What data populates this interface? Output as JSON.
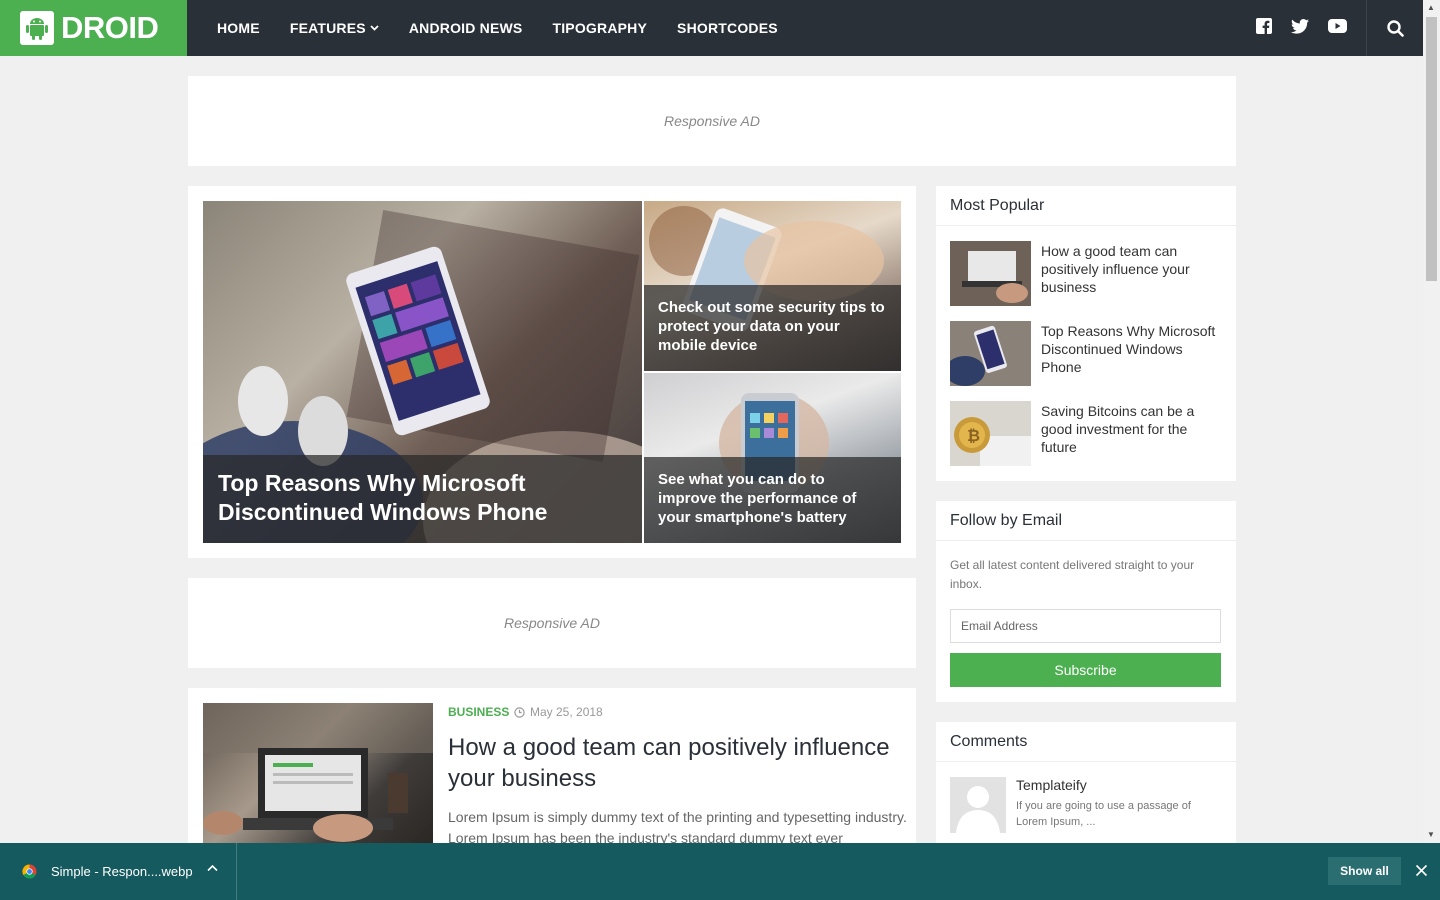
{
  "header": {
    "logo_text": "DROID",
    "nav": [
      {
        "label": "HOME"
      },
      {
        "label": "FEATURES"
      },
      {
        "label": "ANDROID NEWS"
      },
      {
        "label": "TIPOGRAPHY"
      },
      {
        "label": "SHORTCODES"
      }
    ],
    "social_icons": [
      "facebook-icon",
      "twitter-icon",
      "youtube-icon"
    ],
    "search_icon": "search-icon",
    "brand_color": "#4caf50",
    "bar_color": "#2a3038"
  },
  "ads": {
    "top_label": "Responsive AD",
    "mid_label": "Responsive AD"
  },
  "featured": {
    "main_title": "Top Reasons Why Microsoft Discontinued Windows Phone",
    "side_top_title": "Check out some security tips to protect your data on your mobile device",
    "side_bottom_title": "See what you can do to improve the performance of your smartphone's battery"
  },
  "post": {
    "category": "BUSINESS",
    "date": "May 25, 2018",
    "title": "How a good team can positively influence your business",
    "excerpt": "Lorem Ipsum is simply dummy text of the printing and typesetting industry. Lorem Ipsum has been the industry's standard dummy text ever"
  },
  "sidebar": {
    "popular": {
      "title": "Most Popular",
      "items": [
        {
          "title": "How a good team can positively influence your business"
        },
        {
          "title": "Top Reasons Why Microsoft Discontinued Windows Phone"
        },
        {
          "title": "Saving Bitcoins can be a good investment for the future"
        }
      ]
    },
    "follow": {
      "title": "Follow by Email",
      "text": "Get all latest content delivered straight to your inbox.",
      "placeholder": "Email Address",
      "button": "Subscribe"
    },
    "comments": {
      "title": "Comments",
      "author": "Templateify",
      "text": "If you are going to use a passage of Lorem Ipsum, ..."
    }
  },
  "downloads": {
    "file_name": "Simple - Respon....webp",
    "show_all": "Show all"
  }
}
